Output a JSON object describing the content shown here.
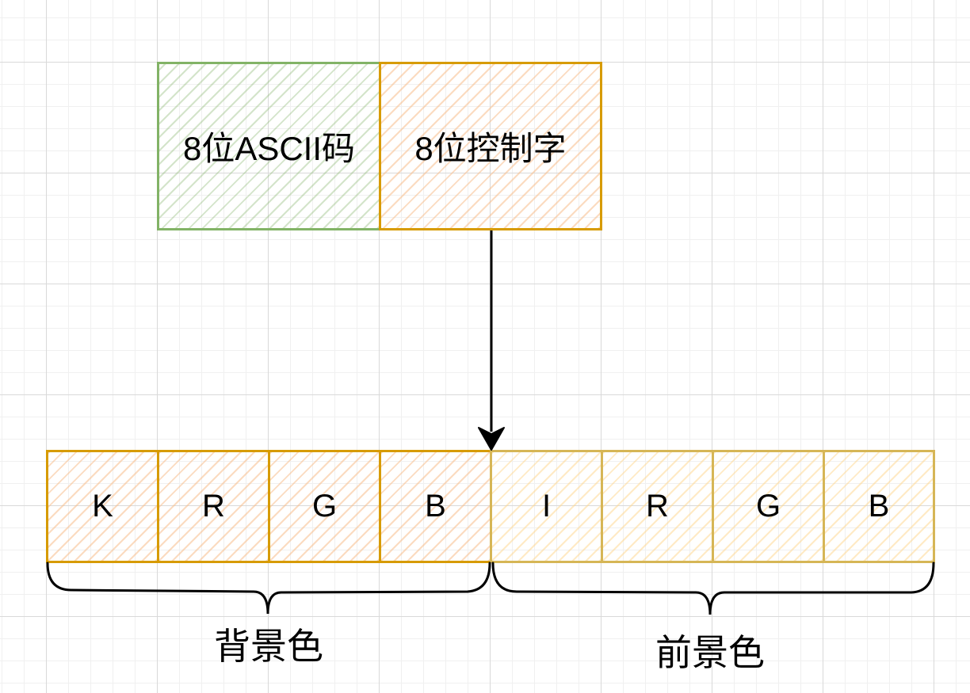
{
  "top_fields": {
    "ascii": "8位ASCII码",
    "control": "8位控制字"
  },
  "bits": [
    "K",
    "R",
    "G",
    "B",
    "I",
    "R",
    "G",
    "B"
  ],
  "groups": {
    "background": "背景色",
    "foreground": "前景色"
  },
  "colors": {
    "green_stroke": "#82b366",
    "orange_stroke": "#d79b00",
    "gold_stroke": "#d6b656",
    "arrow": "#000000"
  }
}
